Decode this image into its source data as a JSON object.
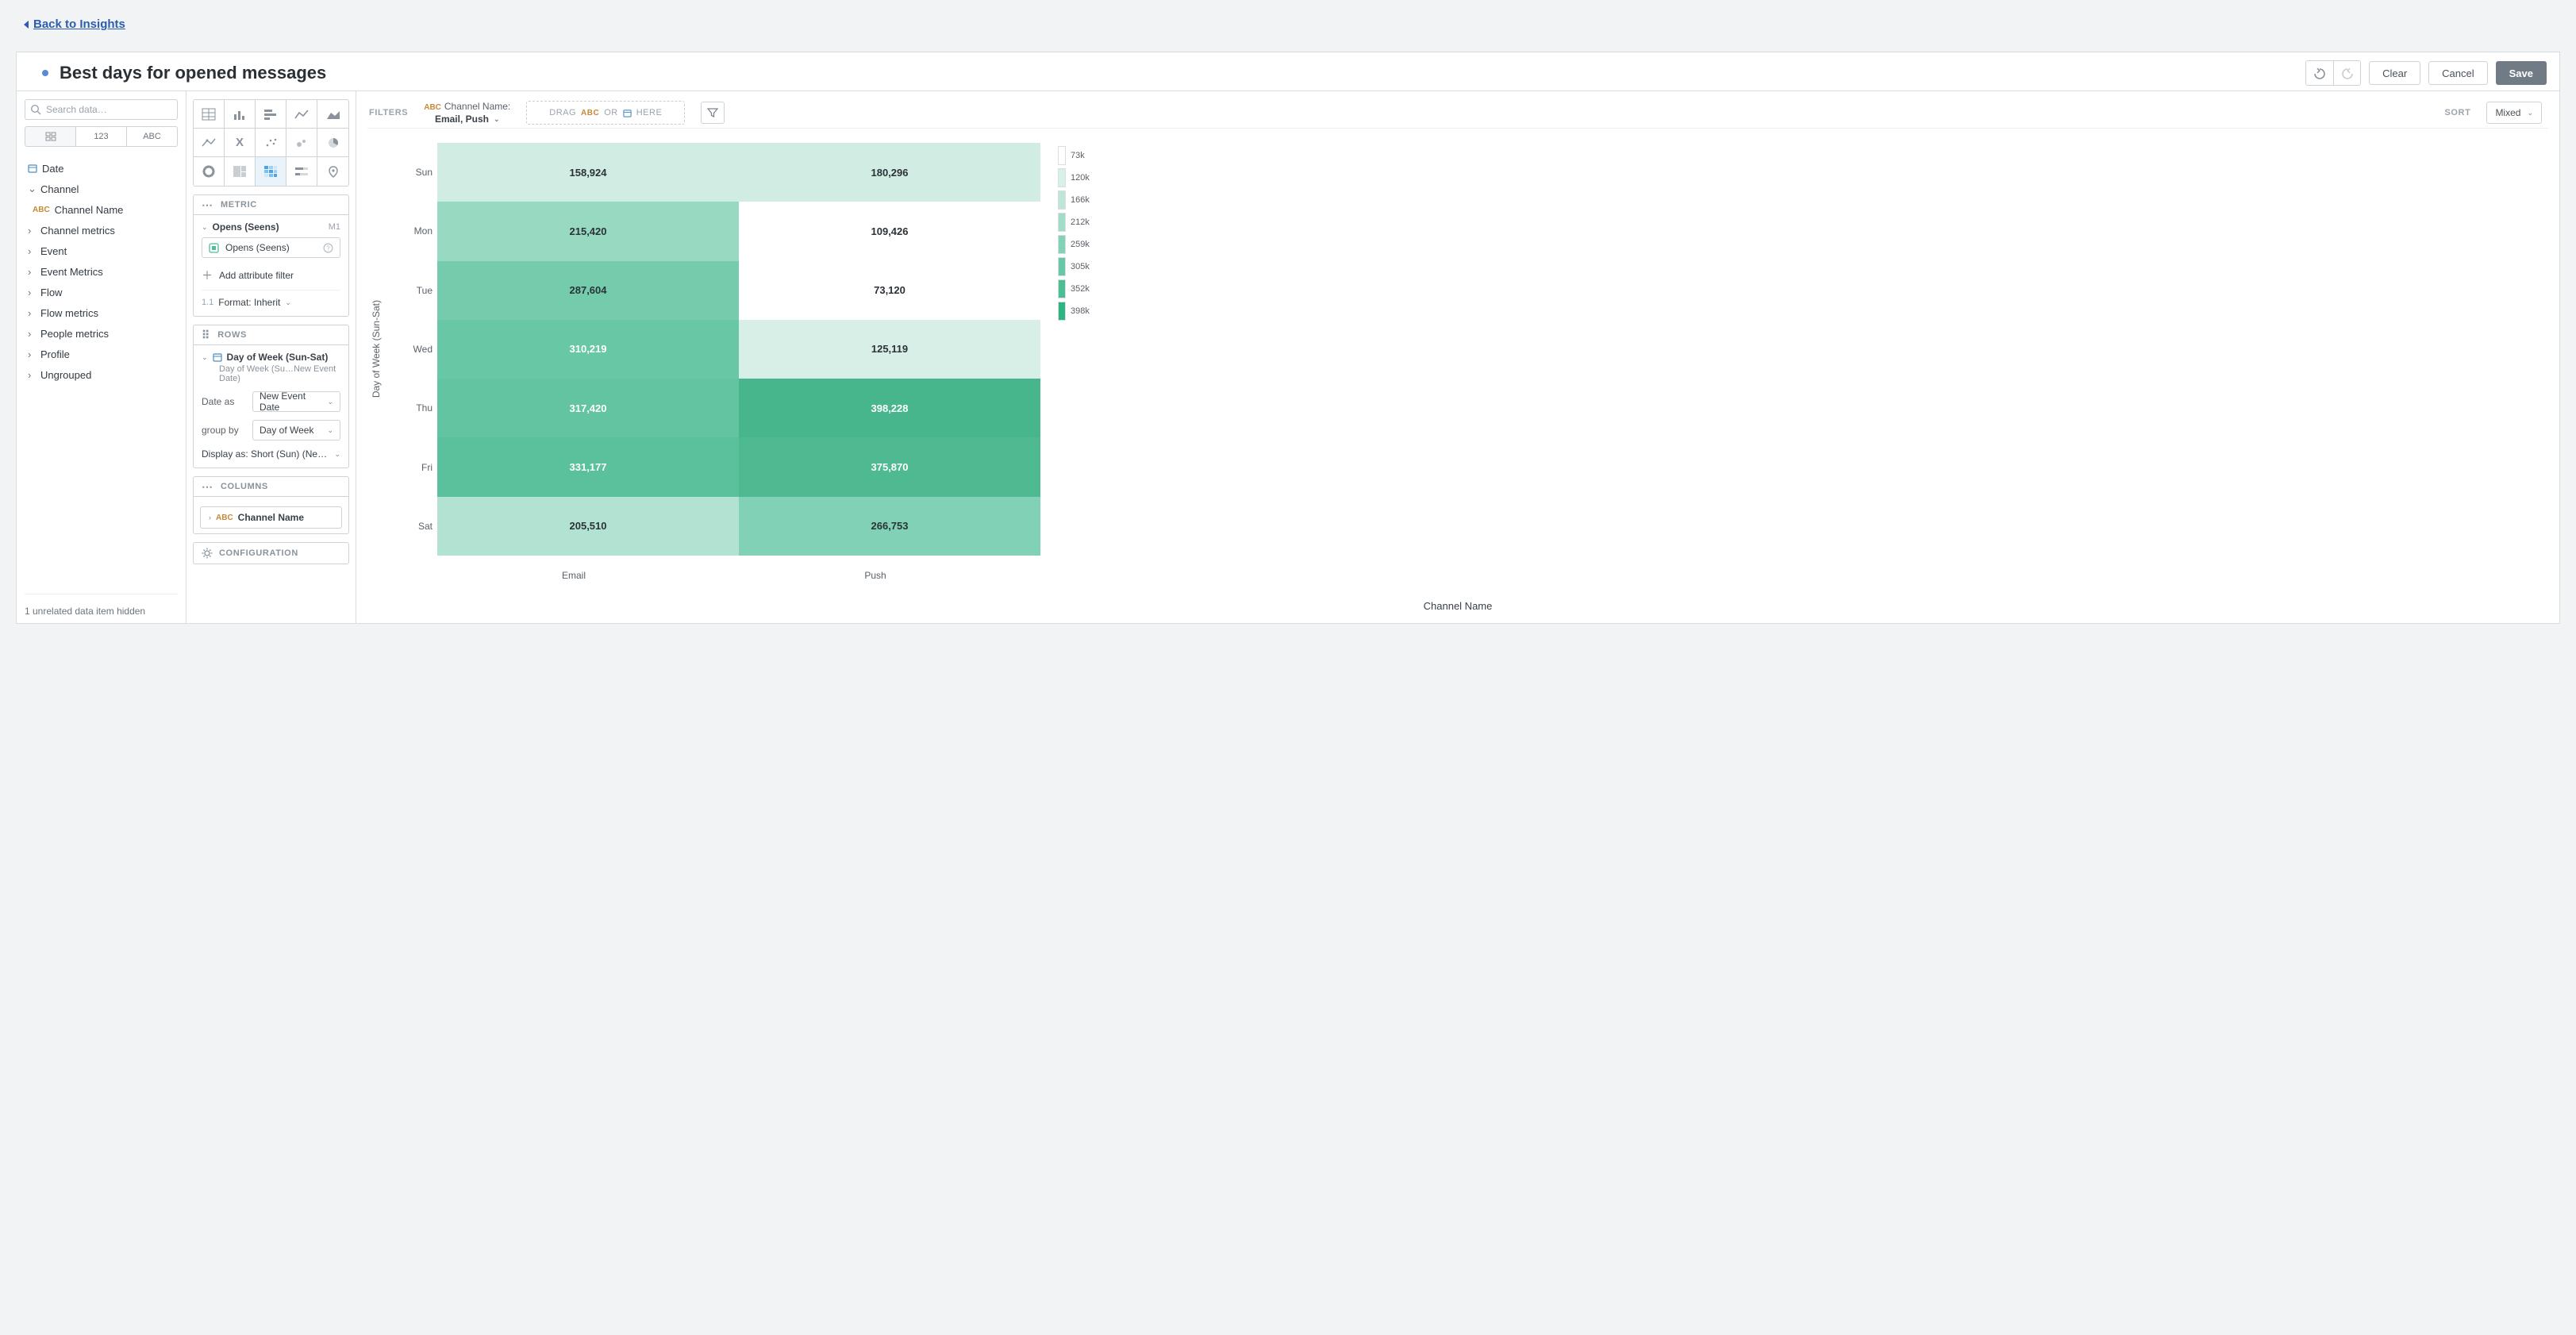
{
  "nav": {
    "back": "Back to Insights"
  },
  "header": {
    "title": "Best days for opened messages",
    "clear": "Clear",
    "cancel": "Cancel",
    "save": "Save"
  },
  "data_panel": {
    "search_placeholder": "Search data…",
    "type_tabs": {
      "num": "123",
      "abc": "ABC"
    },
    "tree": {
      "date": "Date",
      "channel": "Channel",
      "channel_name": "Channel Name",
      "channel_metrics": "Channel metrics",
      "event": "Event",
      "event_metrics": "Event Metrics",
      "flow": "Flow",
      "flow_metrics": "Flow metrics",
      "people_metrics": "People metrics",
      "profile": "Profile",
      "ungrouped": "Ungrouped"
    },
    "footer": "1 unrelated data item hidden"
  },
  "config": {
    "metric": {
      "header": "METRIC",
      "name": "Opens (Seens)",
      "tag": "M1",
      "box_label": "Opens (Seens)",
      "add_filter": "Add attribute filter",
      "format_label": "Format: Inherit",
      "format_tag": "1.1"
    },
    "rows": {
      "header": "ROWS",
      "name": "Day of Week (Sun-Sat)",
      "sub": "Day of Week (Su…New Event Date)",
      "date_as_label": "Date as",
      "date_as_value": "New Event Date",
      "group_by_label": "group by",
      "group_by_value": "Day of Week",
      "display_as": "Display as: Short (Sun) (New …"
    },
    "columns": {
      "header": "COLUMNS",
      "abc": "ABC",
      "value": "Channel Name"
    },
    "configuration": "CONFIGURATION"
  },
  "viz_top": {
    "filters_label": "FILTERS",
    "filter_abc": "ABC",
    "filter_name": "Channel Name:",
    "filter_value": "Email, Push",
    "drag": {
      "drag": "DRAG",
      "abc": "ABC",
      "or": "OR",
      "here": "HERE"
    },
    "sort_label": "SORT",
    "sort_value": "Mixed"
  },
  "chart_data": {
    "type": "heatmap",
    "title": "",
    "xlabel": "Channel Name",
    "ylabel": "Day of Week (Sun-Sat)",
    "x_categories": [
      "Email",
      "Push"
    ],
    "y_categories": [
      "Sun",
      "Mon",
      "Tue",
      "Wed",
      "Thu",
      "Fri",
      "Sat"
    ],
    "values": [
      [
        158924,
        180296
      ],
      [
        215420,
        109426
      ],
      [
        287604,
        73120
      ],
      [
        310219,
        125119
      ],
      [
        317420,
        398228
      ],
      [
        331177,
        375870
      ],
      [
        205510,
        266753
      ]
    ],
    "value_labels": [
      [
        "158,924",
        "180,296"
      ],
      [
        "215,420",
        "109,426"
      ],
      [
        "287,604",
        "73,120"
      ],
      [
        "310,219",
        "125,119"
      ],
      [
        "317,420",
        "398,228"
      ],
      [
        "331,177",
        "375,870"
      ],
      [
        "205,510",
        "266,753"
      ]
    ],
    "cell_colors": [
      [
        "#d0ece3",
        "#d0ece3"
      ],
      [
        "#97d9c1",
        "#ffffff"
      ],
      [
        "#74ccad",
        "#ffffff"
      ],
      [
        "#68c7a5",
        "#d7efe7"
      ],
      [
        "#62c4a1",
        "#47b68d"
      ],
      [
        "#5bc19d",
        "#4fba92"
      ],
      [
        "#b2e3d2",
        "#80d1b5"
      ]
    ],
    "cell_textdark": [
      [
        false,
        false
      ],
      [
        false,
        false
      ],
      [
        false,
        false
      ],
      [
        true,
        false
      ],
      [
        true,
        true
      ],
      [
        true,
        true
      ],
      [
        false,
        false
      ]
    ],
    "legend": [
      {
        "color": "#ffffff",
        "label": "73k"
      },
      {
        "color": "#d9f0e9",
        "label": "120k"
      },
      {
        "color": "#bde6d8",
        "label": "166k"
      },
      {
        "color": "#a0dcc6",
        "label": "212k"
      },
      {
        "color": "#84d2b5",
        "label": "259k"
      },
      {
        "color": "#67c8a3",
        "label": "305k"
      },
      {
        "color": "#4bbe92",
        "label": "352k"
      },
      {
        "color": "#2eb480",
        "label": "398k"
      }
    ]
  }
}
